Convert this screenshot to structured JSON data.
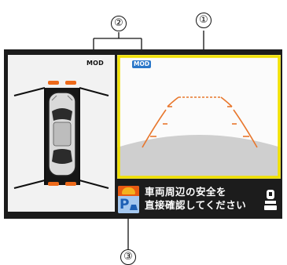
{
  "callouts": {
    "one": "①",
    "two": "②",
    "three": "③"
  },
  "mod_labels": {
    "topview": "MOD",
    "camera": "MOD"
  },
  "message": {
    "line1": "車両周辺の安全を",
    "line2": "直接確認してください"
  },
  "parking_sign": {
    "letter": "P"
  },
  "icons": {
    "car": "car-top-view-icon",
    "parking_sensor": "parking-sensor-icon",
    "person": "person-seat-icon"
  },
  "colors": {
    "screen_bg": "#1c1c1c",
    "highlight_border": "#f0e000",
    "guide_lines": "#e8772d",
    "sensor_marks": "#ee6a1a",
    "mod_badge": "#2a77c9",
    "camera_bg": "#fbfbfb",
    "ground": "#cfcfcf"
  }
}
